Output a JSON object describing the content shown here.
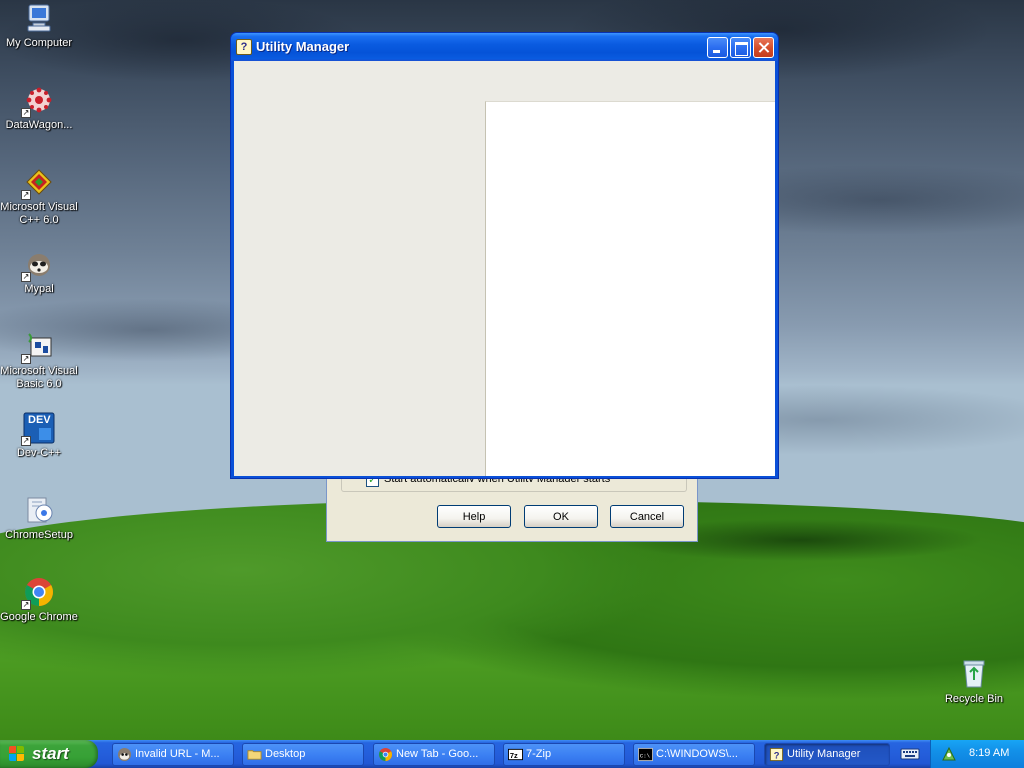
{
  "desktop": {
    "icons": [
      {
        "label": "My Computer",
        "icon": "my-computer-icon",
        "shortcut": false
      },
      {
        "label": "DataWagon...",
        "icon": "datawagon-icon",
        "shortcut": true
      },
      {
        "label": "Microsoft Visual C++ 6.0",
        "icon": "visual-cpp-icon",
        "shortcut": true
      },
      {
        "label": "Mypal",
        "icon": "mypal-icon",
        "shortcut": true
      },
      {
        "label": "Microsoft Visual Basic 6.0",
        "icon": "visual-basic-icon",
        "shortcut": true
      },
      {
        "label": "Dev-C++",
        "icon": "dev-cpp-icon",
        "shortcut": true
      },
      {
        "label": "ChromeSetup",
        "icon": "chrome-setup-icon",
        "shortcut": false
      },
      {
        "label": "Google Chrome",
        "icon": "google-chrome-icon",
        "shortcut": true
      },
      {
        "label": "Recycle Bin",
        "icon": "recycle-bin-icon",
        "shortcut": false
      }
    ],
    "dev_badge": "DEV"
  },
  "window": {
    "title": "Utility Manager",
    "icon": "utility-manager-icon",
    "buttons": [
      "minimize",
      "maximize",
      "close"
    ]
  },
  "back_dialog": {
    "checkbox_label": "Start automatically when Utility Manager starts",
    "checkbox_checked": true,
    "help_label": "Help",
    "ok_label": "OK",
    "cancel_label": "Cancel"
  },
  "taskbar": {
    "start_label": "start",
    "tasks": [
      {
        "label": "Invalid URL - M...",
        "icon": "mypal-icon",
        "active": false
      },
      {
        "label": "Desktop",
        "icon": "folder-icon",
        "active": false
      },
      {
        "label": "New Tab - Goo...",
        "icon": "chrome-icon",
        "active": false
      },
      {
        "label": "7-Zip",
        "icon": "7zip-icon",
        "active": false
      },
      {
        "label": "C:\\WINDOWS\\...",
        "icon": "cmd-icon",
        "active": false
      },
      {
        "label": "Utility Manager",
        "icon": "utility-manager-icon",
        "active": true
      }
    ],
    "clock": "8:19 AM"
  },
  "colors": {
    "taskbar_blue": "#245edb",
    "start_green": "#37a136",
    "window_title_blue": "#0553d8",
    "dialog_face": "#ece9d8"
  }
}
